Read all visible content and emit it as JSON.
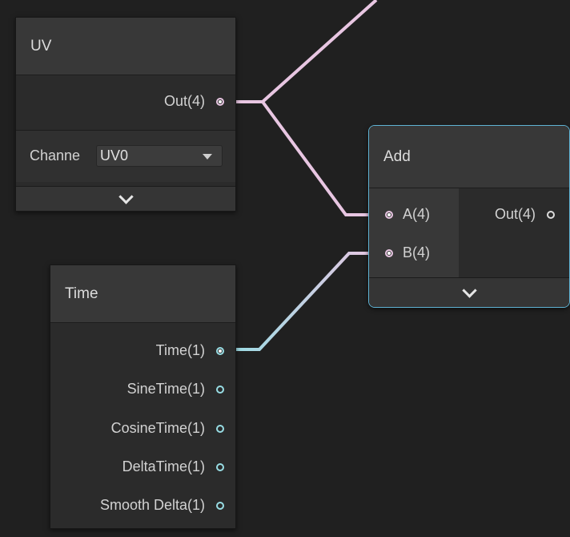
{
  "uv_node": {
    "title": "UV",
    "output_label": "Out(4)",
    "channel_label": "Channe",
    "channel_value": "UV0"
  },
  "add_node": {
    "title": "Add",
    "input_a": "A(4)",
    "input_b": "B(4)",
    "output_label": "Out(4)"
  },
  "time_node": {
    "title": "Time",
    "outputs": [
      "Time(1)",
      "SineTime(1)",
      "CosineTime(1)",
      "DeltaTime(1)",
      "Smooth Delta(1)"
    ]
  },
  "colors": {
    "background": "#202020",
    "vector4_wire": "#e8c6e2",
    "float_wire": "#98dde4",
    "selection_outline": "#5fb3d4"
  },
  "icons": [
    "chevron-down-icon",
    "dropdown-arrow-icon",
    "port-icon"
  ]
}
